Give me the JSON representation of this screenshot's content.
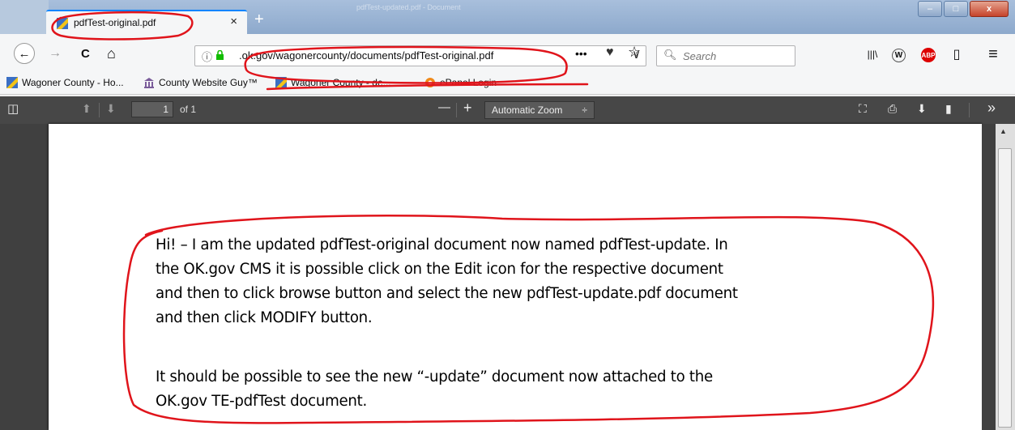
{
  "browser": {
    "tab": {
      "title": "pdfTest-original.pdf",
      "close_glyph": "×",
      "icon": "pdf-favicon-icon"
    },
    "new_tab_glyph": "+",
    "ghost_tab_title": "pdfTest-updated.pdf - Document",
    "window_buttons": {
      "minimize": "–",
      "maximize": "□",
      "close": "x"
    },
    "nav": {
      "back_glyph": "←",
      "forward_glyph": "→",
      "reload_glyph": "C",
      "home_glyph": "⌂",
      "url_prefix": ".",
      "url": "ok.gov/wagonercounty/documents/pdfTest-original.pdf",
      "url_dropdown_glyph": "∨",
      "page_actions_glyph": "•••",
      "pocket_glyph": "♥",
      "bookmark_glyph": "☆",
      "search_placeholder": "Search",
      "library_glyph": "|||\\",
      "w_glyph": "W",
      "abp_label": "ABP",
      "sidebar_glyph": "▯",
      "menu_glyph": "≡"
    },
    "bookmarks": [
      {
        "label": "Wagoner County - Ho...",
        "icon": "county-favicon-icon"
      },
      {
        "label": "County Website Guy™",
        "icon": "courthouse-icon"
      },
      {
        "label": "Wagoner County - de...",
        "icon": "county-favicon-icon"
      },
      {
        "label": "ePanel Login",
        "icon": "epanel-icon"
      }
    ]
  },
  "pdf_toolbar": {
    "sidebar_toggle_glyph": "◫",
    "prev_glyph": "⬆",
    "next_glyph": "⬇",
    "page_number": "1",
    "of_pages": "of 1",
    "zoom_out_glyph": "—",
    "zoom_in_glyph": "+",
    "zoom_value": "Automatic Zoom",
    "zoom_arrow": "÷",
    "presentation_glyph": "⛶",
    "print_glyph": "⎙",
    "download_glyph": "⬇",
    "bookmark_glyph": "▮",
    "tools_glyph": "»"
  },
  "document": {
    "paragraph1": [
      "Hi! – I am the updated pdfTest-original document now named pdfTest-update.  In",
      "the OK.gov CMS it is possible click on the Edit icon for the respective document",
      "and then to click browse button and select the new pdfTest-update.pdf document",
      "and then click MODIFY button."
    ],
    "paragraph2": [
      "It should be possible to see the new “-update” document now attached to the",
      "OK.gov TE-pdfTest document."
    ]
  },
  "annotation_color": "#e0141b"
}
